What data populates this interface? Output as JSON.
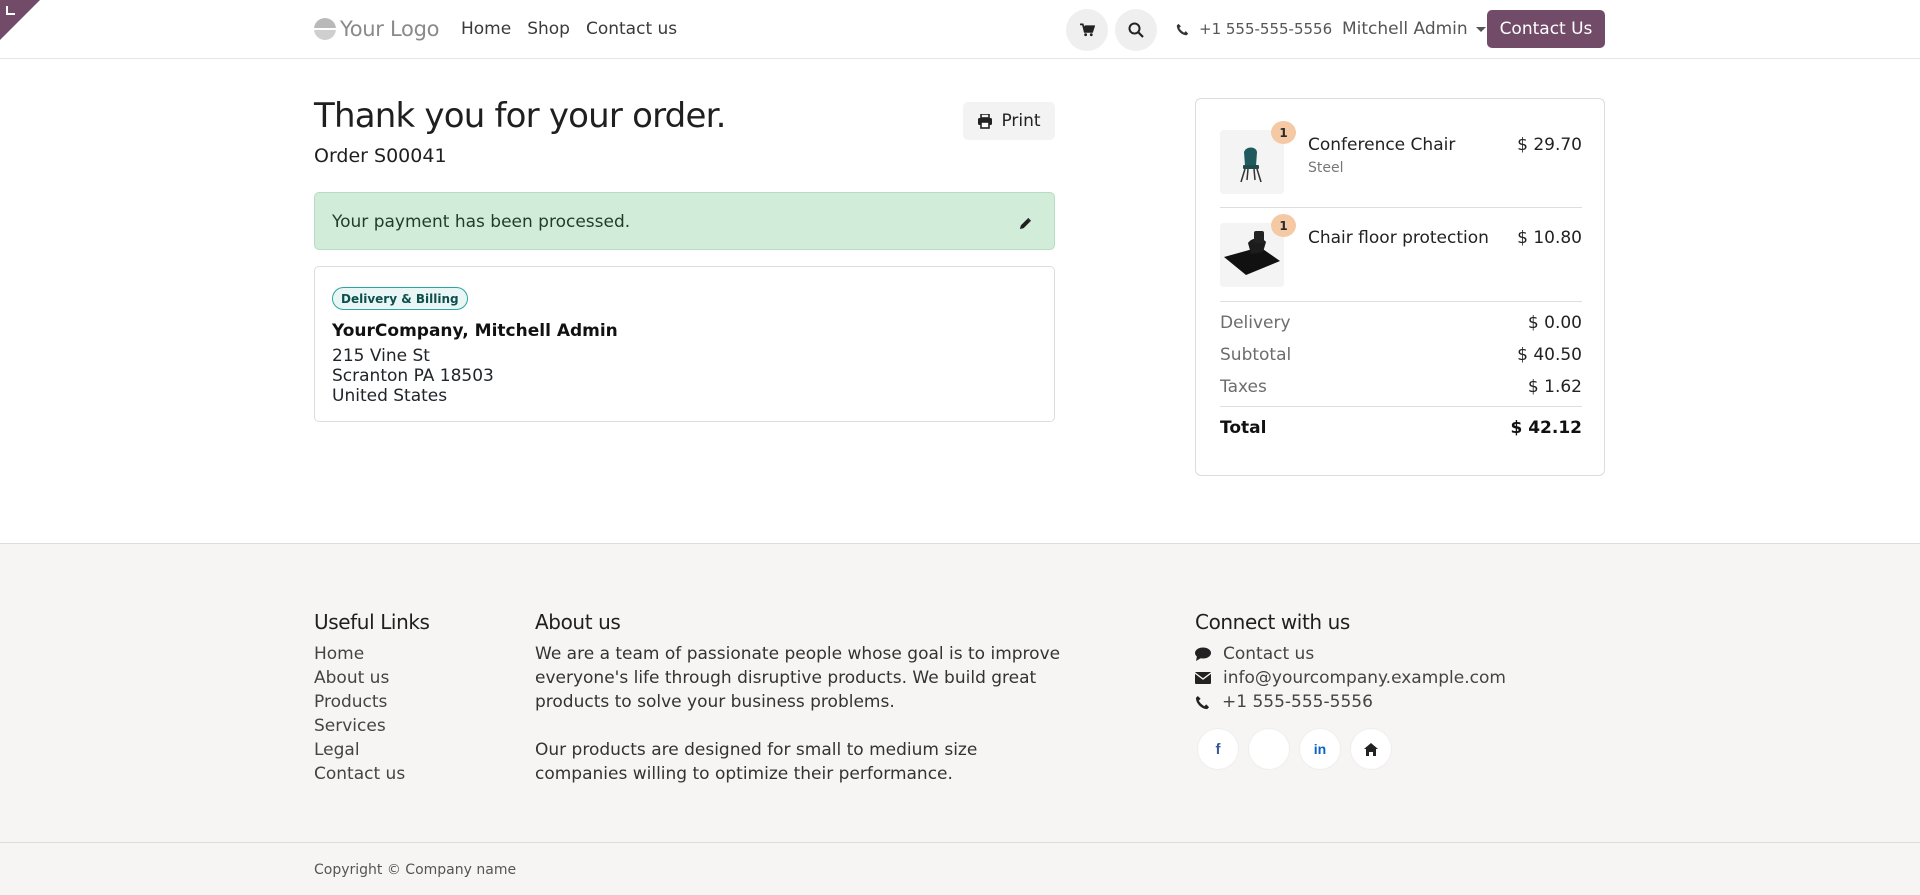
{
  "header": {
    "logo_text": "Your Logo",
    "nav": [
      "Home",
      "Shop",
      "Contact us"
    ],
    "phone": "+1 555-555-5556",
    "user": "Mitchell Admin",
    "contact_button": "Contact Us"
  },
  "main": {
    "title": "Thank you for your order.",
    "order": "Order S00041",
    "print_label": "Print",
    "alert_text": "Your payment has been processed.",
    "address": {
      "badge": "Delivery & Billing",
      "name": "YourCompany, Mitchell Admin",
      "line1": "215 Vine St",
      "line2": "Scranton PA 18503",
      "line3": "United States"
    }
  },
  "summary": {
    "items": [
      {
        "qty": "1",
        "name": "Conference Chair",
        "variant": "Steel",
        "price": "$ 29.70"
      },
      {
        "qty": "1",
        "name": "Chair floor protection",
        "variant": "",
        "price": "$ 10.80"
      }
    ],
    "delivery_label": "Delivery",
    "delivery_value": "$ 0.00",
    "subtotal_label": "Subtotal",
    "subtotal_value": "$ 40.50",
    "taxes_label": "Taxes",
    "taxes_value": "$ 1.62",
    "total_label": "Total",
    "total_value": "$ 42.12"
  },
  "footer": {
    "useful_links_title": "Useful Links",
    "useful_links": [
      "Home",
      "About us",
      "Products",
      "Services",
      "Legal",
      "Contact us"
    ],
    "about_title": "About us",
    "about_p1": "We are a team of passionate people whose goal is to improve everyone's life through disruptive products. We build great products to solve your business problems.",
    "about_p2": "Our products are designed for small to medium size companies willing to optimize their performance.",
    "connect_title": "Connect with us",
    "connect_contact": "Contact us",
    "connect_email": "info@yourcompany.example.com",
    "connect_phone": "+1 555-555-5556",
    "social_icons": [
      "facebook-icon",
      "x-icon",
      "linkedin-icon",
      "home-icon"
    ],
    "copyright": "Copyright © Company name"
  },
  "colors": {
    "brand": "#714b67",
    "success_bg": "#d2ecda",
    "badge_border": "#2aa6a0",
    "qty_badge": "#f5c9a3",
    "footer_bg": "#f6f5f4"
  }
}
